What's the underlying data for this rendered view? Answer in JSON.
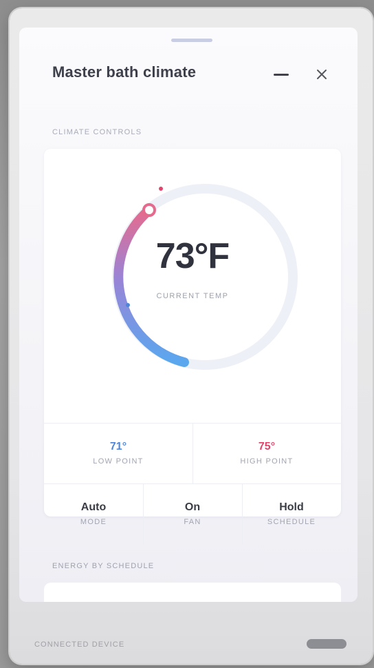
{
  "window": {
    "title": "Master bath climate",
    "minimize_icon": "minimize-icon",
    "close_icon": "close-icon"
  },
  "section_climate": {
    "label": "CLIMATE CONTROLS"
  },
  "thermostat": {
    "current_temp": "73°F",
    "caption": "CURRENT TEMP",
    "colors": {
      "warm": "#e56b8e",
      "cool": "#5aa7ee",
      "track": "#eef0f7"
    }
  },
  "setpoints": {
    "low": {
      "value": "71°",
      "label": "LOW POINT"
    },
    "high": {
      "value": "75°",
      "label": "HIGH POINT"
    }
  },
  "controls": [
    {
      "value": "Auto",
      "label": "MODE"
    },
    {
      "value": "On",
      "label": "FAN"
    },
    {
      "value": "Hold",
      "label": "SCHEDULE"
    }
  ],
  "section_energy": {
    "label": "ENERGY BY SCHEDULE"
  },
  "footer": {
    "label": "CONNECTED DEVICE"
  }
}
